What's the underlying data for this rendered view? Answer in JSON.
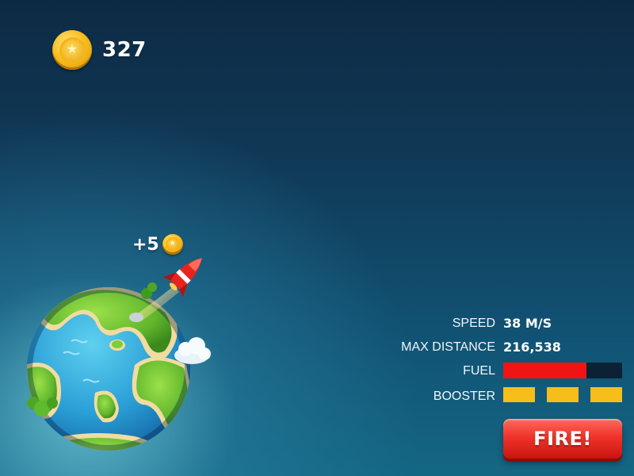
{
  "hud": {
    "coins": "327",
    "coin_icon": "gold-star-coin-icon"
  },
  "reward_popup": {
    "text": "+5",
    "icon": "gold-star-coin-icon"
  },
  "stats": {
    "speed_label": "SPEED",
    "speed_value": "38 M/S",
    "max_distance_label": "MAX DISTANCE",
    "max_distance_value": "216,538",
    "fuel_label": "FUEL",
    "fuel_level": 0.7,
    "booster_label": "BOOSTER",
    "boosters_filled": 3,
    "boosters_total": 3
  },
  "fire_button": {
    "label": "FIRE!"
  },
  "colors": {
    "fuel": "#f01414",
    "fuel_empty": "#0b2136",
    "booster": "#f7bd1a",
    "fire": "#e52620",
    "coin": "#f7c01f"
  }
}
